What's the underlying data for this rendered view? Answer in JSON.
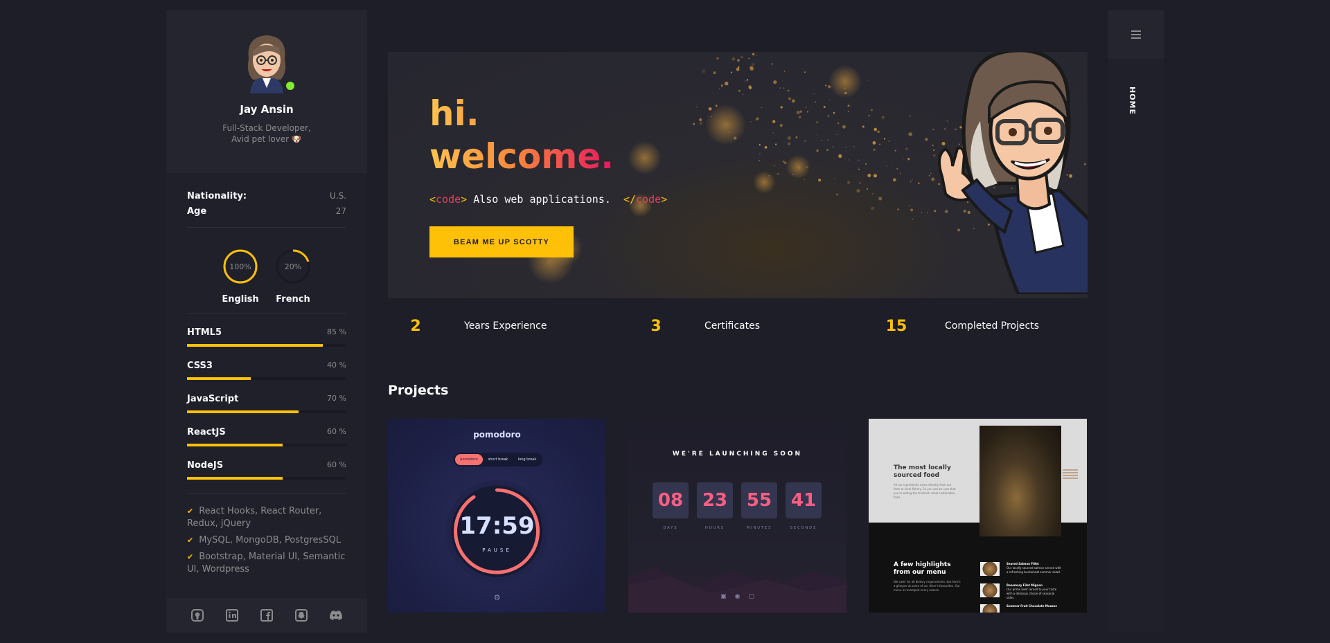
{
  "profile": {
    "name": "Jay Ansin",
    "role_line1": "Full-Stack Developer,",
    "role_line2": "Avid pet lover 🐶",
    "status_color": "#7eef2a"
  },
  "info": [
    {
      "key": "Nationality:",
      "value": "U.S."
    },
    {
      "key": "Age",
      "value": "27"
    }
  ],
  "languages": [
    {
      "name": "English",
      "percent": 100,
      "label": "100%"
    },
    {
      "name": "French",
      "percent": 20,
      "label": "20%"
    }
  ],
  "skills": [
    {
      "name": "HTML5",
      "percent": 85,
      "label": "85 %"
    },
    {
      "name": "CSS3",
      "percent": 40,
      "label": "40 %"
    },
    {
      "name": "JavaScript",
      "percent": 70,
      "label": "70 %"
    },
    {
      "name": "ReactJS",
      "percent": 60,
      "label": "60 %"
    },
    {
      "name": "NodeJS",
      "percent": 60,
      "label": "60 %"
    }
  ],
  "knowledge": [
    "React Hooks, React Router, Redux, jQuery",
    "MySQL, MongoDB, PostgresSQL",
    "Bootstrap, Material UI, Semantic UI, Wordpress"
  ],
  "social_icons": [
    "github-icon",
    "linkedin-icon",
    "facebook-icon",
    "snapchat-icon",
    "discord-icon"
  ],
  "hero": {
    "line1": "hi.",
    "line2": "welcome.",
    "code_open_lt": "<",
    "code_open_tag": "code",
    "code_open_gt": ">",
    "code_text": " Also web applications. ",
    "code_close_lt": "</",
    "code_close_tag": "code",
    "code_close_gt": ">",
    "button": "BEAM ME UP SCOTTY"
  },
  "stats": [
    {
      "num": "2",
      "label": "Years Experience"
    },
    {
      "num": "3",
      "label": "Certificates"
    },
    {
      "num": "15",
      "label": "Completed Projects"
    }
  ],
  "projects_title": "Projects",
  "pomodoro": {
    "title": "pomodoro",
    "tabs": [
      "pomodoro",
      "short break",
      "long break"
    ],
    "time": "17:59",
    "state": "PAUSE"
  },
  "countdown": {
    "title": "WE'RE LAUNCHING SOON",
    "values": [
      "08",
      "23",
      "55",
      "41"
    ],
    "units": [
      "DAYS",
      "HOURS",
      "MINUTES",
      "SECONDS"
    ]
  },
  "restaurant": {
    "h1": "The most locally sourced food",
    "p1": "All our ingredients come directly from our farm or local fishery. So you can be sure that you're eating the freshest, most sustainable food.",
    "h2": "A few highlights from our menu",
    "p2": "We cater for all dietary requirements, but here's a glimpse at some of our diner's favourites. Our menu is revamped every season.",
    "menu": [
      {
        "name": "Seared Salmon Fillet",
        "desc": "Our locally sourced salmon served with a refreshing buckwheat summer salad."
      },
      {
        "name": "Rosemary Filet Mignon",
        "desc": "Our prime beef served to your taste with a delicious choice of seasonal sides."
      },
      {
        "name": "Summer Fruit Chocolate Mousse",
        "desc": ""
      }
    ]
  },
  "nav": {
    "home": "HOME"
  },
  "colors": {
    "accent": "#ffc107",
    "bg": "#1e1e28",
    "panel": "#20202a"
  }
}
